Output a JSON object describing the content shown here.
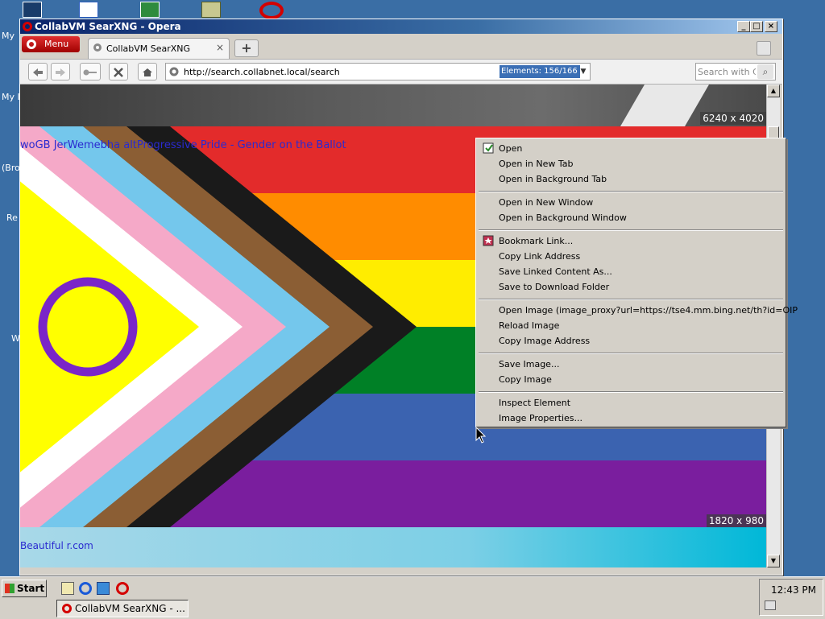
{
  "desktop": {
    "icon_labels": [
      "My",
      "My I",
      "(Bro",
      "Re",
      "W"
    ]
  },
  "window": {
    "title": "CollabVM SearXNG - Opera",
    "controls": {
      "minimize": "_",
      "maximize": "□",
      "close": "×"
    }
  },
  "tabs": {
    "menu_label": "Menu",
    "active_tab_label": "CollabVM SearXNG",
    "close_symbol": "×",
    "new_tab_symbol": "+"
  },
  "toolbar": {
    "address": "http://search.collabnet.local/search",
    "elements_badge": "Elements:   156/166",
    "search_placeholder": "Search with Co"
  },
  "content": {
    "top_image_size": "6240 x 4020",
    "flag_image_size": "1820 x 980",
    "overlay_title": "woGB JerWemebha altProgressive Pride - Gender on the Ballot",
    "overlay_source": "Beautiful r.com"
  },
  "context_menu": {
    "items": [
      "Open",
      "Open in New Tab",
      "Open in Background Tab",
      "Open in New Window",
      "Open in Background Window",
      "Bookmark Link...",
      "Copy Link Address",
      "Save Linked Content As...",
      "Save to Download Folder",
      "Open Image (image_proxy?url=https://tse4.mm.bing.net/th?id=OIP",
      "Reload Image",
      "Copy Image Address",
      "Save Image...",
      "Copy Image",
      "Inspect Element",
      "Image Properties..."
    ]
  },
  "taskbar": {
    "start_label": "Start",
    "task_label": "CollabVM SearXNG - ...",
    "clock": "12:43 PM"
  },
  "colors": {
    "title_bar": "#0a246a",
    "flag_red": "#e32b2b",
    "flag_orange": "#ff8c00",
    "flag_yellow": "#ffed00",
    "flag_green": "#008026",
    "flag_blue": "#3b63b0",
    "flag_purple": "#7a1e9e",
    "intersex_yellow": "#ffff00",
    "intersex_ring": "#7a25c8"
  }
}
